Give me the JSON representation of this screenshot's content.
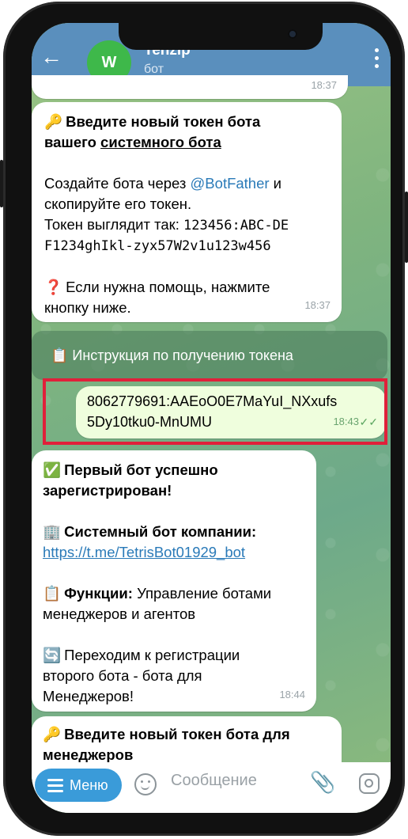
{
  "header": {
    "back_icon": "arrow-left-icon",
    "avatar_letter": "W",
    "title": "Tenzip",
    "subtitle": "бот",
    "menu_icon": "more-vertical-icon"
  },
  "messages": {
    "top_partial_time": "18:37",
    "m1": {
      "emoji_key": "🔑",
      "line1_bold": "Введите новый токен бота",
      "line2_bold_prefix": "вашего ",
      "line2_bold_underline": "системного бота",
      "p2a_prefix": "Создайте бота через ",
      "p2a_link": "@BotFather",
      "p2a_suffix": " и",
      "p2b": "скопируйте его токен.",
      "p2c": "Токен выглядит так: ",
      "p2c_mono": "123456:ABC-DE",
      "p2d_mono": "F1234ghIkl-zyx57W2v1u123w456",
      "emoji_question": "❓",
      "p3a": "Если нужна помощь, нажмите",
      "p3b": "кнопку ниже.",
      "time": "18:37"
    },
    "inline_button": {
      "icon": "clipboard-icon",
      "label": "📋 Инструкция по получению токена"
    },
    "outgoing": {
      "line1": "8062779691:AAEoO0E7MaYuI_NXxufs",
      "line2": "5Dy10tku0-MnUMU",
      "time": "18:43",
      "status": "✓✓"
    },
    "m2": {
      "e1": "✅",
      "l1": "Первый бот успешно",
      "l2": "зарегистрирован!",
      "e2": "🏢",
      "l3": "Системный бот компании:",
      "link": "https://t.me/TetrisBot01929_bot",
      "e3": "📋",
      "l4_bold": "Функции:",
      "l4_rest": " Управление ботами",
      "l5": "менеджеров и агентов",
      "e4": "🔄",
      "l6": "Переходим к регистрации",
      "l7": "второго бота - бота для",
      "l8": "Менеджеров!",
      "time": "18:44"
    },
    "m3": {
      "emoji_key": "🔑",
      "l1": "Введите новый токен бота для",
      "l2": "менеджеров"
    }
  },
  "bottom": {
    "menu_label": "Меню",
    "input_placeholder": "Сообщение",
    "attach_icon": "paperclip-icon",
    "camera_icon": "instagram-camera-icon"
  }
}
